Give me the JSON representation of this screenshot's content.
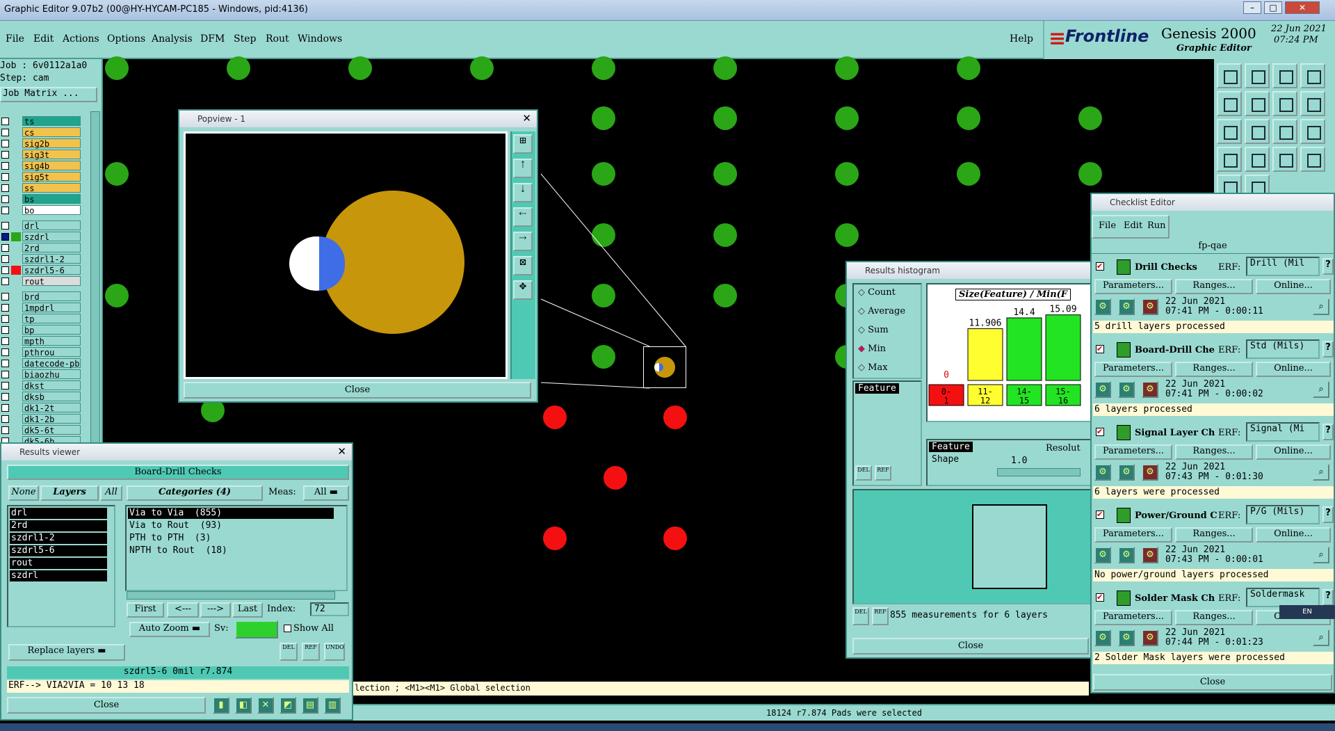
{
  "window": {
    "title": "Graphic Editor 9.07b2 (00@HY-HYCAM-PC185 - Windows, pid:4136)"
  },
  "menu": [
    "File",
    "Edit",
    "Actions",
    "Options",
    "Analysis",
    "DFM",
    "Step",
    "Rout",
    "Windows"
  ],
  "help": "Help",
  "brand": {
    "logo": "Frontline",
    "product": "Genesis 2000",
    "subtitle": "Graphic Editor",
    "date": "22 Jun 2021",
    "time": "07:24 PM"
  },
  "job": {
    "job": "Job : 6v0112a1a0",
    "step": "Step: cam",
    "matrix": "Job Matrix ..."
  },
  "layers": [
    {
      "name": "ts",
      "color": "#1fa58e",
      "swatch": ""
    },
    {
      "name": "cs",
      "color": "#f2c24c",
      "swatch": ""
    },
    {
      "name": "sig2b",
      "color": "#f2c24c",
      "swatch": ""
    },
    {
      "name": "sig3t",
      "color": "#f2c24c",
      "swatch": ""
    },
    {
      "name": "sig4b",
      "color": "#f2c24c",
      "swatch": ""
    },
    {
      "name": "sig5t",
      "color": "#f2c24c",
      "swatch": ""
    },
    {
      "name": "ss",
      "color": "#f2c24c",
      "swatch": ""
    },
    {
      "name": "bs",
      "color": "#1fa58e",
      "swatch": ""
    },
    {
      "name": "bo",
      "color": "#ffffff",
      "swatch": ""
    },
    {
      "name": "drl",
      "color": "#9ad9d0",
      "swatch": ""
    },
    {
      "name": "szdrl",
      "color": "#9ad9d0",
      "swatch": "#2aa616"
    },
    {
      "name": "2rd",
      "color": "#9ad9d0",
      "swatch": ""
    },
    {
      "name": "szdrl1-2",
      "color": "#9ad9d0",
      "swatch": ""
    },
    {
      "name": "szdrl5-6",
      "color": "#9ad9d0",
      "swatch": "#f41010"
    },
    {
      "name": "rout",
      "color": "#dcdcdc",
      "swatch": ""
    },
    {
      "name": "brd",
      "color": "#9ad9d0",
      "swatch": ""
    },
    {
      "name": "1mpdrl",
      "color": "#9ad9d0",
      "swatch": ""
    },
    {
      "name": "tp",
      "color": "#9ad9d0",
      "swatch": ""
    },
    {
      "name": "bp",
      "color": "#9ad9d0",
      "swatch": ""
    },
    {
      "name": "mpth",
      "color": "#9ad9d0",
      "swatch": ""
    },
    {
      "name": "pthrou",
      "color": "#9ad9d0",
      "swatch": ""
    },
    {
      "name": "datecode-pb",
      "color": "#9ad9d0",
      "swatch": ""
    },
    {
      "name": "biaozhu",
      "color": "#9ad9d0",
      "swatch": ""
    },
    {
      "name": "dkst",
      "color": "#9ad9d0",
      "swatch": ""
    },
    {
      "name": "dksb",
      "color": "#9ad9d0",
      "swatch": ""
    },
    {
      "name": "dk1-2t",
      "color": "#9ad9d0",
      "swatch": ""
    },
    {
      "name": "dk1-2b",
      "color": "#9ad9d0",
      "swatch": ""
    },
    {
      "name": "dk5-6t",
      "color": "#9ad9d0",
      "swatch": ""
    },
    {
      "name": "dk5-6b",
      "color": "#9ad9d0",
      "swatch": ""
    }
  ],
  "popview": {
    "title": "Popview - 1",
    "close": "Close"
  },
  "results_viewer": {
    "title": "Results viewer",
    "check": "Board-Drill Checks",
    "none": "None",
    "layers": "Layers",
    "all": "All",
    "categories_label": "Categories (4)",
    "meas_label": "Meas:",
    "meas_value": "All",
    "layer_list": [
      "drl",
      "2rd",
      "szdrl1-2",
      "szdrl5-6",
      "rout",
      "szdrl"
    ],
    "categories": [
      "Via to Via  (855)",
      "Via to Rout  (93)",
      "PTH to PTH  (3)",
      "NPTH to Rout  (18)"
    ],
    "first": "First",
    "prev": "<---",
    "next": "--->",
    "last": "Last",
    "index_label": "Index:",
    "index_value": "72",
    "zoom": "Auto Zoom",
    "sv": "Sv:",
    "show_all": "Show All",
    "replace": "Replace layers",
    "info": "szdrl5-6 0mil  r7.874",
    "erf": "ERF--> VIA2VIA = 10 13 18",
    "close": "Close",
    "del": "DEL",
    "ref": "REF",
    "undo": "UNDO"
  },
  "histogram": {
    "title": "Results histogram",
    "options": [
      "Count",
      "Average",
      "Sum",
      "Min",
      "Max"
    ],
    "selected": "Min",
    "feature": "Feature",
    "header": "Size(Feature) / Min(F",
    "bars": [
      {
        "label": "0-\n1",
        "value": 0
      },
      {
        "label": "11-\n12",
        "value": 11.906
      },
      {
        "label": "14-\n15",
        "value": 14.4
      },
      {
        "label": "15-\n16",
        "value": 15.09
      }
    ],
    "value_labels": [
      "0",
      "11.906",
      "14.4",
      "15.09"
    ],
    "bin_labels": [
      "0-1",
      "11-12",
      "14-15",
      "15-16"
    ],
    "feature_shape": [
      "Feature",
      "Shape"
    ],
    "resolution_label": "Resolut",
    "resolution_value": "1.0",
    "summary": "855 measurements for 6 layers",
    "close": "Close",
    "del": "DEL",
    "ref": "REF"
  },
  "checklist": {
    "title": "Checklist Editor",
    "menu": [
      "File",
      "Edit",
      "Run"
    ],
    "name": "fp-qae",
    "checks": [
      {
        "name": "Drill Checks",
        "erf": "Drill (Mil",
        "date": "22 Jun 2021",
        "time": "07:41 PM - 0:00:11",
        "status": "5 drill layers processed"
      },
      {
        "name": "Board-Drill Che",
        "erf": "Std (Mils)",
        "date": "22 Jun 2021",
        "time": "07:41 PM - 0:00:02",
        "status": "6 layers processed"
      },
      {
        "name": "Signal Layer Ch",
        "erf": "Signal (Mi",
        "date": "22 Jun 2021",
        "time": "07:43 PM - 0:01:30",
        "status": "6 layers were processed"
      },
      {
        "name": "Power/Ground C",
        "erf": "P/G (Mils)",
        "date": "22 Jun 2021",
        "time": "07:43 PM - 0:00:01",
        "status": "No power/ground layers processed"
      },
      {
        "name": "Solder Mask Ch",
        "erf": "Soldermask",
        "date": "22 Jun 2021",
        "time": "07:44 PM - 0:01:23",
        "status": "2 Solder Mask layers were processed"
      }
    ],
    "erf_label": "ERF:",
    "params": "Parameters...",
    "ranges": "Ranges...",
    "online": "Online...",
    "close": "Close"
  },
  "prompt": "lection ; <M1><M1> Global selection",
  "status": "18124 r7.874 Pads were selected",
  "ime": "EN"
}
